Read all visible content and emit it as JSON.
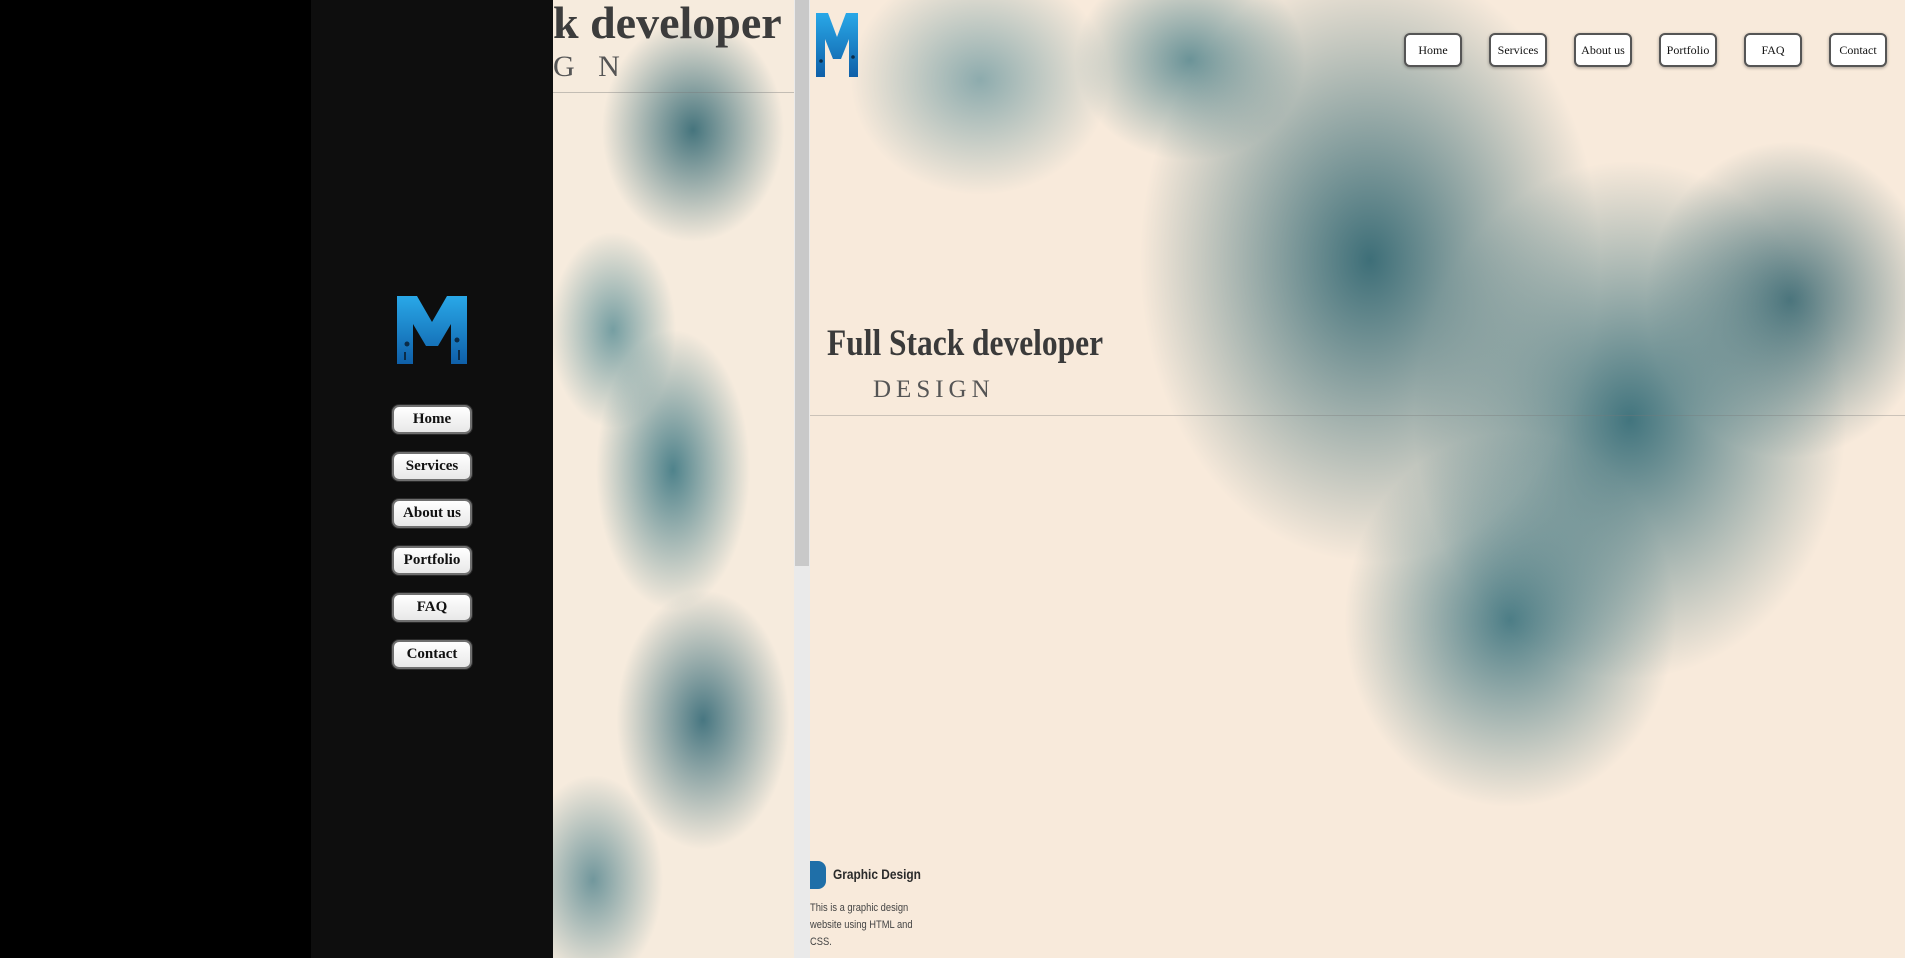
{
  "brand": {
    "logo_icon": "m-circuit-logo",
    "color": "#1a8fd6"
  },
  "nav": {
    "items": [
      {
        "label": "Home"
      },
      {
        "label": "Services"
      },
      {
        "label": "About us"
      },
      {
        "label": "Portfolio"
      },
      {
        "label": "FAQ"
      },
      {
        "label": "Contact"
      }
    ]
  },
  "hero": {
    "title": "Full Stack developer",
    "subtitle": "DESIGN",
    "partial_title": "k developer",
    "partial_subtitle": "G N"
  },
  "card": {
    "title": "Graphic Design",
    "description": "This is a graphic design website using HTML and CSS.",
    "icon_color": "#1f6fa8"
  },
  "colors": {
    "background": "#f8eadb",
    "smoke": "#3c6c76",
    "side_panel": "#0e0e0e"
  }
}
